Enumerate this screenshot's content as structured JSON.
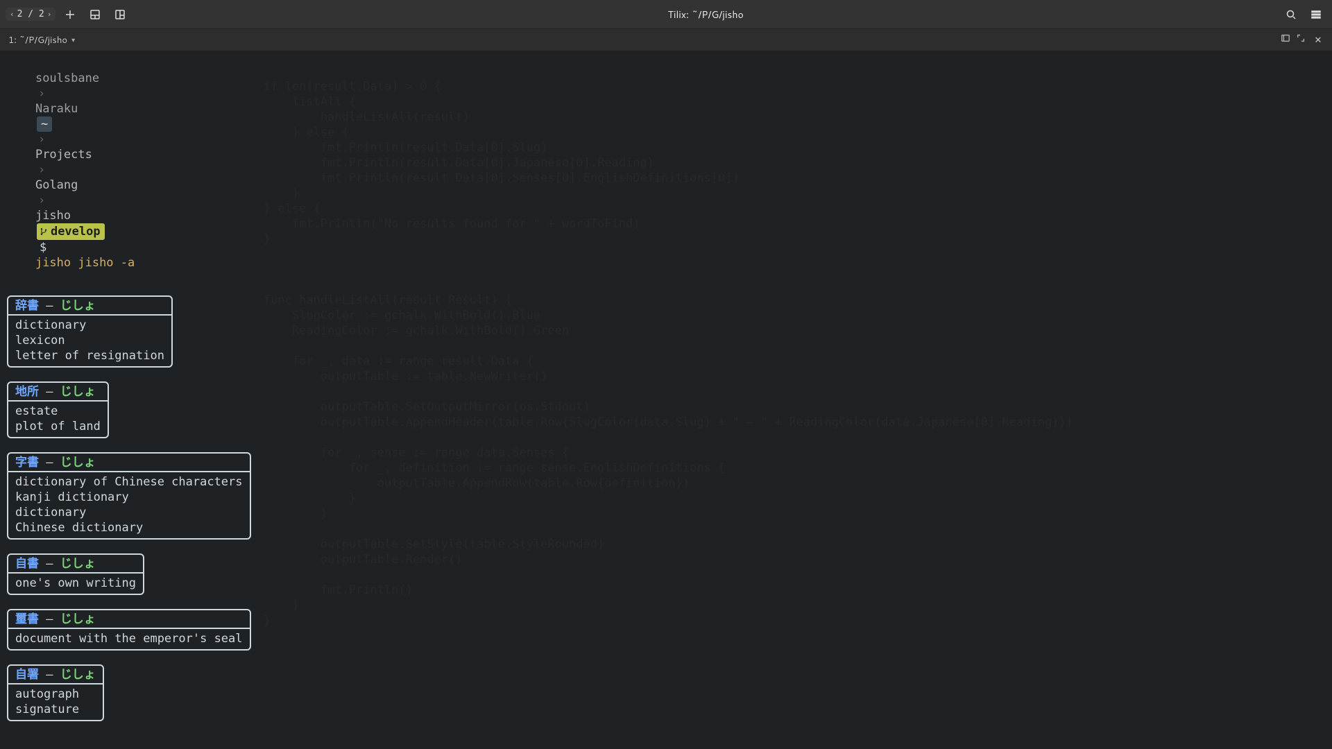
{
  "window": {
    "title": "Tilix: ~/P/G/jisho",
    "page_indicator": "2 / 2"
  },
  "tab": {
    "label": "1: ~/P/G/jisho"
  },
  "prompt": {
    "user": "soulsbane",
    "host": "Naraku",
    "home_glyph": "~",
    "path_parts": [
      "Projects",
      "Golang",
      "jisho"
    ],
    "branch": "develop",
    "symbol": "$",
    "command": "jisho jisho -a"
  },
  "sep": "›",
  "dash": " – ",
  "results": [
    {
      "slug": "辞書",
      "reading": "じしょ",
      "defs": [
        "dictionary",
        "lexicon",
        "letter of resignation"
      ]
    },
    {
      "slug": "地所",
      "reading": "じしょ",
      "defs": [
        "estate",
        "plot of land"
      ]
    },
    {
      "slug": "字書",
      "reading": "じしょ",
      "defs": [
        "dictionary of Chinese characters",
        "kanji dictionary",
        "dictionary",
        "Chinese dictionary"
      ]
    },
    {
      "slug": "自書",
      "reading": "じしょ",
      "defs": [
        "one's own writing"
      ]
    },
    {
      "slug": "璽書",
      "reading": "じしょ",
      "defs": [
        "document with the emperor's seal"
      ]
    },
    {
      "slug": "自署",
      "reading": "じしょ",
      "defs": [
        "autograph",
        "signature"
      ]
    }
  ],
  "ghost_code": "if len(result.Data) > 0 {\n    listAll {\n        handleListAll(result)\n    } else {\n        fmt.Println(result.Data[0].Slug)\n        fmt.Println(result.Data[0].Japanese[0].Reading)\n        fmt.Println(result.Data[0].Senses[0].EnglishDefinitions[0])\n    }\n} else {\n    fmt.Println(\"No results found for \" + wordToFind)\n}\n\n\n\nfunc handleListAll(result Result) {\n    SlugColor := gchalk.WithBold().Blue\n    ReadingColor := gchalk.WithBold().Green\n\n    for _, data := range result.Data {\n        outputTable := table.NewWriter()\n\n        outputTable.SetOutputMirror(os.Stdout)\n        outputTable.AppendHeader(table.Row{SlugColor(data.Slug) + \" – \" + ReadingColor(data.Japanese[0].Reading)})\n\n        for _, sense := range data.Senses {\n            for _, definition := range sense.EnglishDefinitions {\n                outputTable.AppendRow(table.Row{definition})\n            }\n        }\n\n        outputTable.SetStyle(table.StyleRounded)\n        outputTable.Render()\n\n        fmt.Println()\n    }\n}"
}
